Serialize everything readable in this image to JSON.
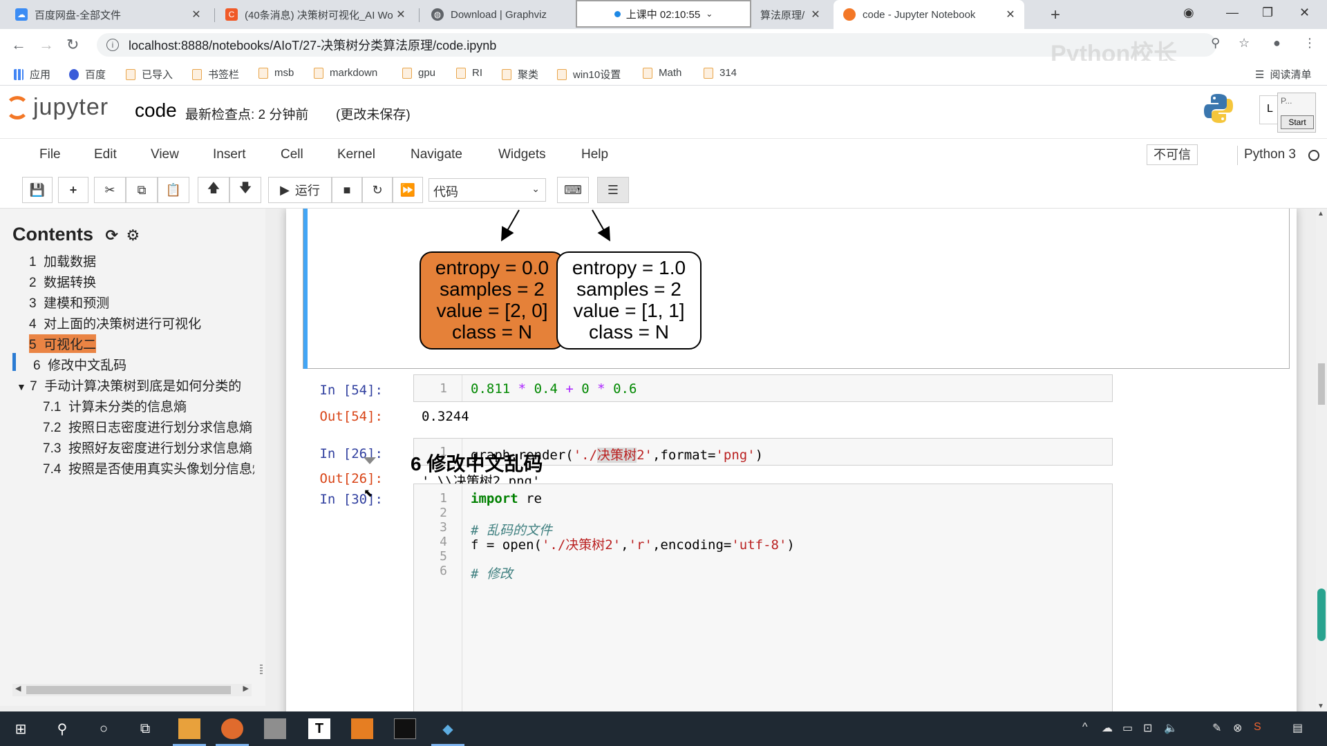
{
  "browser": {
    "tabs": [
      {
        "title": "百度网盘-全部文件",
        "active": false
      },
      {
        "title": "(40条消息) 决策树可视化_AI Wo",
        "active": false
      },
      {
        "title": "Download | Graphviz",
        "active": false
      },
      {
        "title": "算法原理/",
        "active": false
      },
      {
        "title": "code - Jupyter Notebook",
        "active": true
      }
    ],
    "recording": "上课中 02:10:55",
    "url": "localhost:8888/notebooks/AIoT/27-决策树分类算法原理/code.ipynb",
    "watermark": "Python校长",
    "bookmarks": [
      "应用",
      "百度",
      "已导入",
      "书签栏",
      "msb",
      "markdown",
      "gpu",
      "RI",
      "聚类",
      "win10设置",
      "Math",
      "314"
    ],
    "reading_list": "阅读清单"
  },
  "jupyter": {
    "logo_text": "jupyter",
    "notebook_name": "code",
    "checkpoint": "最新检查点: 2 分钟前",
    "unsaved": "(更改未保存)",
    "logout": "L",
    "panel_label": "P...",
    "panel_start": "Start",
    "menu": [
      "File",
      "Edit",
      "View",
      "Insert",
      "Cell",
      "Kernel",
      "Navigate",
      "Widgets",
      "Help"
    ],
    "trust": "不可信",
    "kernel": "Python 3",
    "run_label": "运行",
    "cell_type": "代码"
  },
  "toc": {
    "title": "Contents",
    "items": [
      {
        "num": "1",
        "label": "加载数据"
      },
      {
        "num": "2",
        "label": "数据转换"
      },
      {
        "num": "3",
        "label": "建模和预测"
      },
      {
        "num": "4",
        "label": "对上面的决策树进行可视化"
      },
      {
        "num": "5",
        "label": "可视化二"
      },
      {
        "num": "6",
        "label": "修改中文乱码"
      },
      {
        "num": "7",
        "label": "手动计算决策树到底是如何分类的"
      },
      {
        "num": "7.1",
        "label": "计算未分类的信息熵"
      },
      {
        "num": "7.2",
        "label": "按照日志密度进行划分求信息熵"
      },
      {
        "num": "7.3",
        "label": "按照好友密度进行划分求信息熵"
      },
      {
        "num": "7.4",
        "label": "按照是否使用真实头像划分信息熵"
      }
    ]
  },
  "tree_nodes": [
    {
      "lines": [
        "entropy = 0.0",
        "samples = 2",
        "value = [2, 0]",
        "class = N"
      ],
      "color": "#e58139"
    },
    {
      "lines": [
        "entropy = 1.0",
        "samples = 2",
        "value = [1, 1]",
        "class = N"
      ],
      "color": "#ffffff"
    }
  ],
  "cells": {
    "c54": {
      "in_prompt": "In  [54]:",
      "out_prompt": "Out[54]:",
      "line_no": "1",
      "output": "0.3244",
      "tokens": [
        "0.811",
        "*",
        "0.4",
        "+",
        "0",
        "*",
        "0.6"
      ]
    },
    "c26": {
      "in_prompt": "In  [26]:",
      "out_prompt": "Out[26]:",
      "line_no": "1",
      "output": "'.\\\\决策树2.png'",
      "code_a": "graph.render(",
      "str_a": "'./",
      "hl": "决策树",
      "str_b": "2'",
      "code_b": ",format=",
      "str_c": "'png'",
      "code_c": ")"
    },
    "heading": "6  修改中文乱码",
    "c30": {
      "in_prompt": "In  [30]:",
      "lines": [
        {
          "n": "1",
          "kw": "import",
          "rest": " re"
        },
        {
          "n": "2"
        },
        {
          "n": "3",
          "comment": "# 乱码的文件"
        },
        {
          "n": "4",
          "pre": "f = open(",
          "s1": "'./决策树2'",
          "mid": ",",
          "s2": "'r'",
          "mid2": ",encoding=",
          "s3": "'utf-8'",
          "post": ")"
        },
        {
          "n": "5"
        },
        {
          "n": "6",
          "comment": "# 修改"
        }
      ]
    }
  }
}
